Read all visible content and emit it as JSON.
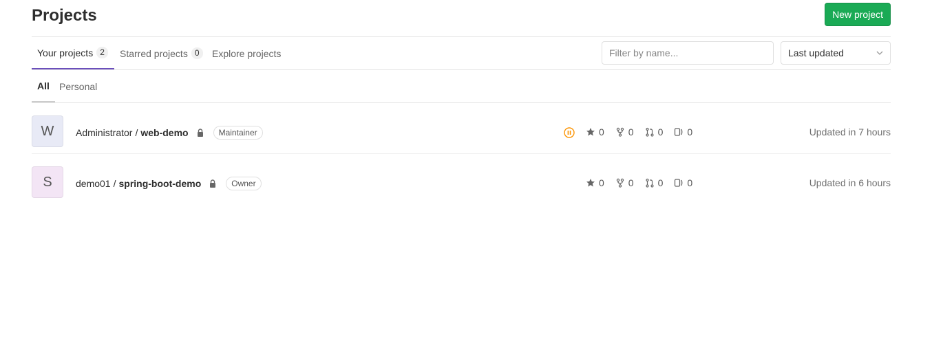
{
  "header": {
    "title": "Projects",
    "new_project_label": "New project"
  },
  "tabs": [
    {
      "label": "Your projects",
      "count": "2"
    },
    {
      "label": "Starred projects",
      "count": "0"
    },
    {
      "label": "Explore projects"
    }
  ],
  "filter": {
    "placeholder": "Filter by name...",
    "value": ""
  },
  "sort": {
    "selected": "Last updated"
  },
  "subtabs": [
    {
      "label": "All"
    },
    {
      "label": "Personal"
    }
  ],
  "projects": [
    {
      "avatar_letter": "W",
      "avatar_color": "#e8eaf6",
      "namespace": "Administrator",
      "separator": "/",
      "name": "web-demo",
      "role": "Maintainer",
      "pipeline_status": "paused",
      "pipeline_color": "#fc9403",
      "stars": "0",
      "forks": "0",
      "merge_requests": "0",
      "issues": "0",
      "updated": "Updated in 7 hours"
    },
    {
      "avatar_letter": "S",
      "avatar_color": "#f3e5f5",
      "namespace": "demo01",
      "separator": "/",
      "name": "spring-boot-demo",
      "role": "Owner",
      "stars": "0",
      "forks": "0",
      "merge_requests": "0",
      "issues": "0",
      "updated": "Updated in 6 hours"
    }
  ],
  "colors": {
    "accent": "#6b4fbb",
    "new_button": "#1aaa55"
  }
}
